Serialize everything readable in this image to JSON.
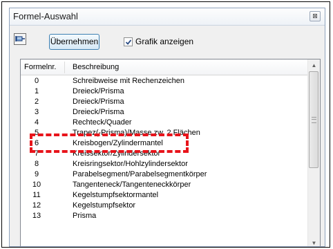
{
  "window": {
    "title": "Formel-Auswahl",
    "close_glyph": "⊠"
  },
  "toolbar": {
    "pin_icon": "pin-icon",
    "apply_label": "Übernehmen",
    "show_graphic_label": "Grafik anzeigen",
    "show_graphic_checked": true
  },
  "list": {
    "columns": [
      "Formelnr.",
      "Beschreibung"
    ],
    "rows": [
      {
        "nr": "0",
        "desc": "Schreibweise mit Rechenzeichen"
      },
      {
        "nr": "1",
        "desc": "Dreieck/Prisma"
      },
      {
        "nr": "2",
        "desc": "Dreieck/Prisma"
      },
      {
        "nr": "3",
        "desc": "Dreieck/Prisma"
      },
      {
        "nr": "4",
        "desc": "Rechteck/Quader"
      },
      {
        "nr": "5",
        "desc": "Trapez(-Prisma)/Masse zw. 2 Flächen"
      },
      {
        "nr": "6",
        "desc": "Kreisbogen/Zylindermantel"
      },
      {
        "nr": "7",
        "desc": "Kreissektor/Zylindersektor"
      },
      {
        "nr": "8",
        "desc": "Kreisringsektor/Hohlzylindersektor"
      },
      {
        "nr": "9",
        "desc": "Parabelsegment/Parabelsegmentkörper"
      },
      {
        "nr": "10",
        "desc": "Tangenteneck/Tangenteneckkörper"
      },
      {
        "nr": "11",
        "desc": "Kegelstumpfsektormantel"
      },
      {
        "nr": "12",
        "desc": "Kegelstumpfsektor"
      },
      {
        "nr": "13",
        "desc": "Prisma"
      }
    ]
  },
  "highlight": {
    "color": "#e8141b",
    "style": "dashed"
  }
}
